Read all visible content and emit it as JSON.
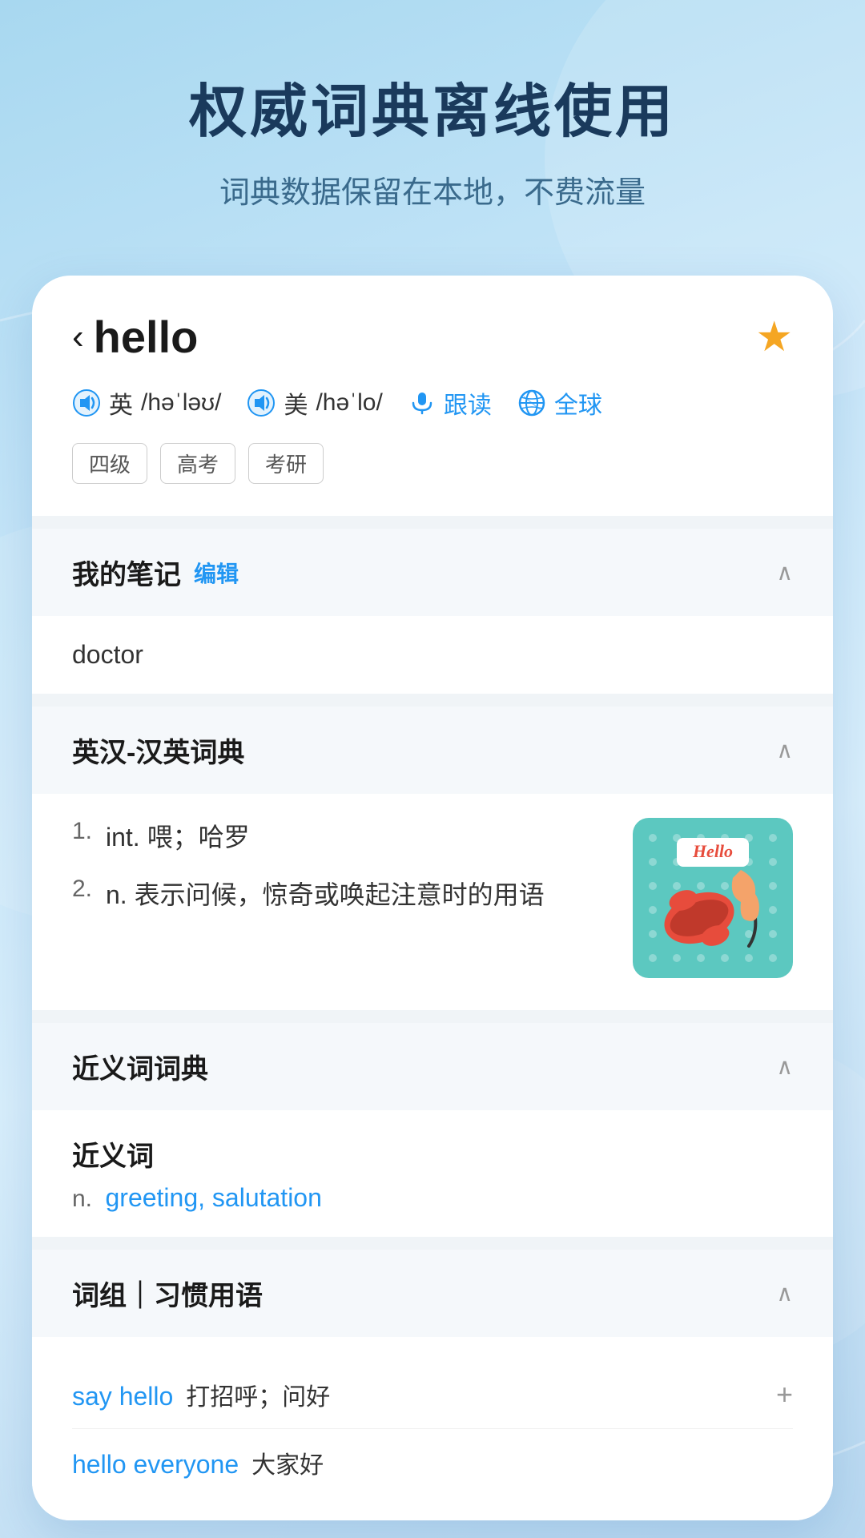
{
  "app": {
    "title": "权威词典离线使用",
    "subtitle": "词典数据保留在本地，不费流量"
  },
  "word": {
    "back_icon": "‹",
    "text": "hello",
    "is_starred": true,
    "pronunciations": {
      "british": {
        "label": "英",
        "phonetic": "/həˈləʊ/"
      },
      "american": {
        "label": "美",
        "phonetic": "/həˈlo/"
      }
    },
    "follow_read": "跟读",
    "global": "全球",
    "tags": [
      "四级",
      "高考",
      "考研"
    ]
  },
  "sections": {
    "notes": {
      "title": "我的笔记",
      "edit_label": "编辑",
      "content": "doctor"
    },
    "dictionary": {
      "title": "英汉-汉英词典",
      "definitions": [
        {
          "num": "1.",
          "pos": "int.",
          "text": "喂；哈罗"
        },
        {
          "num": "2.",
          "pos": "n.",
          "text": "表示问候，惊奇或唤起注意时的用语"
        }
      ]
    },
    "synonyms": {
      "title": "近义词词典",
      "label": "近义词",
      "pos": "n.",
      "words": "greeting, salutation"
    },
    "phrases": {
      "title": "词组｜习惯用语",
      "items": [
        {
          "en": "say hello",
          "cn": "打招呼；问好"
        },
        {
          "en": "hello everyone",
          "cn": "大家好"
        }
      ]
    }
  },
  "icons": {
    "back": "‹",
    "star": "★",
    "chevron_up": "∧",
    "mic": "🎤",
    "plus": "+"
  }
}
